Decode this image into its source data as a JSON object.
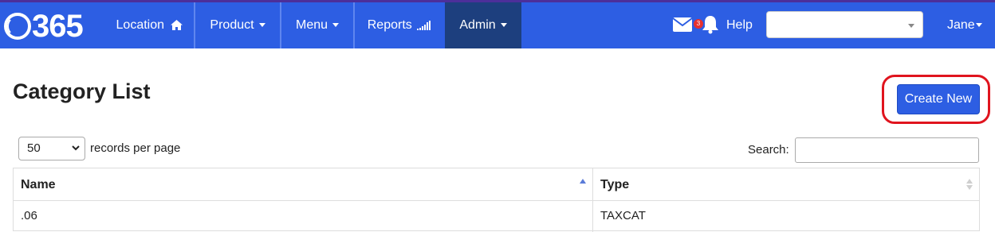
{
  "app": {
    "logo_text": "365"
  },
  "nav": {
    "items": [
      {
        "label": "Location"
      },
      {
        "label": "Product"
      },
      {
        "label": "Menu"
      },
      {
        "label": "Reports"
      },
      {
        "label": "Admin",
        "active": true
      }
    ],
    "mail_badge": "3",
    "help_label": "Help",
    "selector_value": "",
    "user_label": "Jane"
  },
  "page": {
    "title": "Category List",
    "create_button_label": "Create New"
  },
  "table_controls": {
    "page_length": "50",
    "page_length_suffix": "records per page",
    "search_label": "Search:",
    "search_value": ""
  },
  "table": {
    "columns": [
      {
        "label": "Name",
        "sort": "asc"
      },
      {
        "label": "Type",
        "sort": "none"
      }
    ],
    "rows": [
      {
        "name": ".06",
        "type": "TAXCAT"
      }
    ]
  },
  "colors": {
    "navbar": "#2d5ee3",
    "active_nav": "#1d3f7e",
    "button": "#2d5ee3",
    "highlight_ring": "#e0141e"
  }
}
